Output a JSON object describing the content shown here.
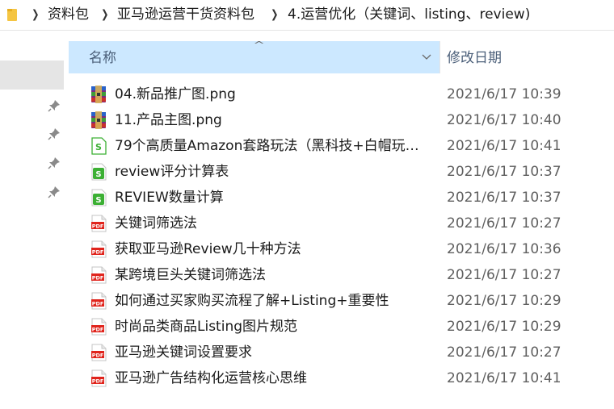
{
  "breadcrumb": {
    "items": [
      "资料包",
      "亚马逊运营干货资料包",
      "4.运营优化（关键词、listing、review)"
    ]
  },
  "columns": {
    "name": "名称",
    "date": "修改日期"
  },
  "files": [
    {
      "name": "04.新品推广图.png",
      "date": "2021/6/17 10:39",
      "icon": "winrar-archive-icon"
    },
    {
      "name": "11.产品主图.png",
      "date": "2021/6/17 10:40",
      "icon": "winrar-archive-icon"
    },
    {
      "name": "79个高质量Amazon套路玩法（黑科技+白帽玩…",
      "date": "2021/6/17 10:41",
      "icon": "spreadsheet-outline-icon"
    },
    {
      "name": "review评分计算表",
      "date": "2021/6/17 10:37",
      "icon": "spreadsheet-icon"
    },
    {
      "name": "REVIEW数量计算",
      "date": "2021/6/17 10:37",
      "icon": "spreadsheet-icon"
    },
    {
      "name": "关键词筛选法",
      "date": "2021/6/17 10:27",
      "icon": "pdf-icon"
    },
    {
      "name": "获取亚马逊Review几十种方法",
      "date": "2021/6/17 10:36",
      "icon": "pdf-icon"
    },
    {
      "name": "某跨境巨头关键词筛选法",
      "date": "2021/6/17 10:27",
      "icon": "pdf-icon"
    },
    {
      "name": "如何通过买家购买流程了解+Listing+重要性",
      "date": "2021/6/17 10:29",
      "icon": "pdf-icon"
    },
    {
      "name": "时尚品类商品Listing图片规范",
      "date": "2021/6/17 10:29",
      "icon": "pdf-icon"
    },
    {
      "name": "亚马逊关键词设置要求",
      "date": "2021/6/17 10:27",
      "icon": "pdf-icon"
    },
    {
      "name": "亚马逊广告结构化运营核心思维",
      "date": "2021/6/17 10:41",
      "icon": "pdf-icon"
    }
  ],
  "icons": {
    "pdf_label": "PDF",
    "spreadsheet_label": "S"
  },
  "colors": {
    "header_selected": "#cce8ff",
    "pdf_red": "#e0241c",
    "sheet_green": "#3cb034",
    "folder_yellow": "#f5c542"
  }
}
